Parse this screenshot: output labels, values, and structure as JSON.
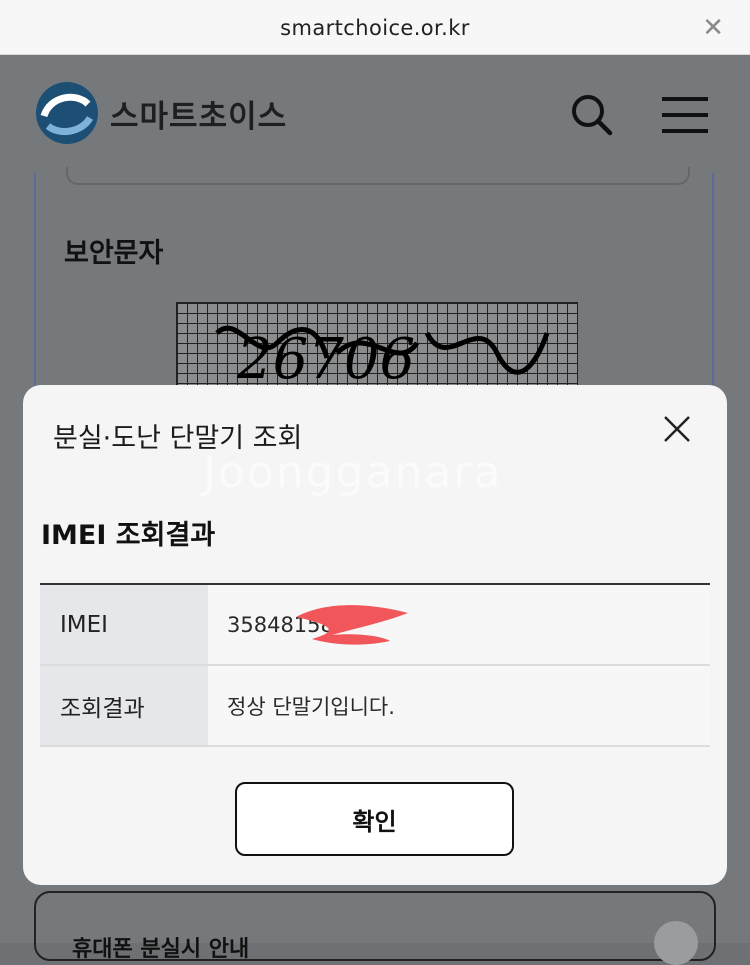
{
  "browser": {
    "url": "smartchoice.or.kr",
    "close_icon": "close-icon"
  },
  "site": {
    "logo_text": "스마트초이스",
    "security_label": "보안문자",
    "captcha_text": "26706",
    "bottom_card_text": "휴대폰 분실시 안내"
  },
  "modal": {
    "title": "분실·도난 단말기 조회",
    "watermark": "Joongganara",
    "section_title": "IMEI 조회결과",
    "rows": [
      {
        "label": "IMEI",
        "value": "35848158"
      },
      {
        "label": "조회결과",
        "value": "정상 단말기입니다."
      }
    ],
    "confirm_label": "확인"
  },
  "colors": {
    "brand": "#1d4f74",
    "redaction": "#f0565a"
  }
}
